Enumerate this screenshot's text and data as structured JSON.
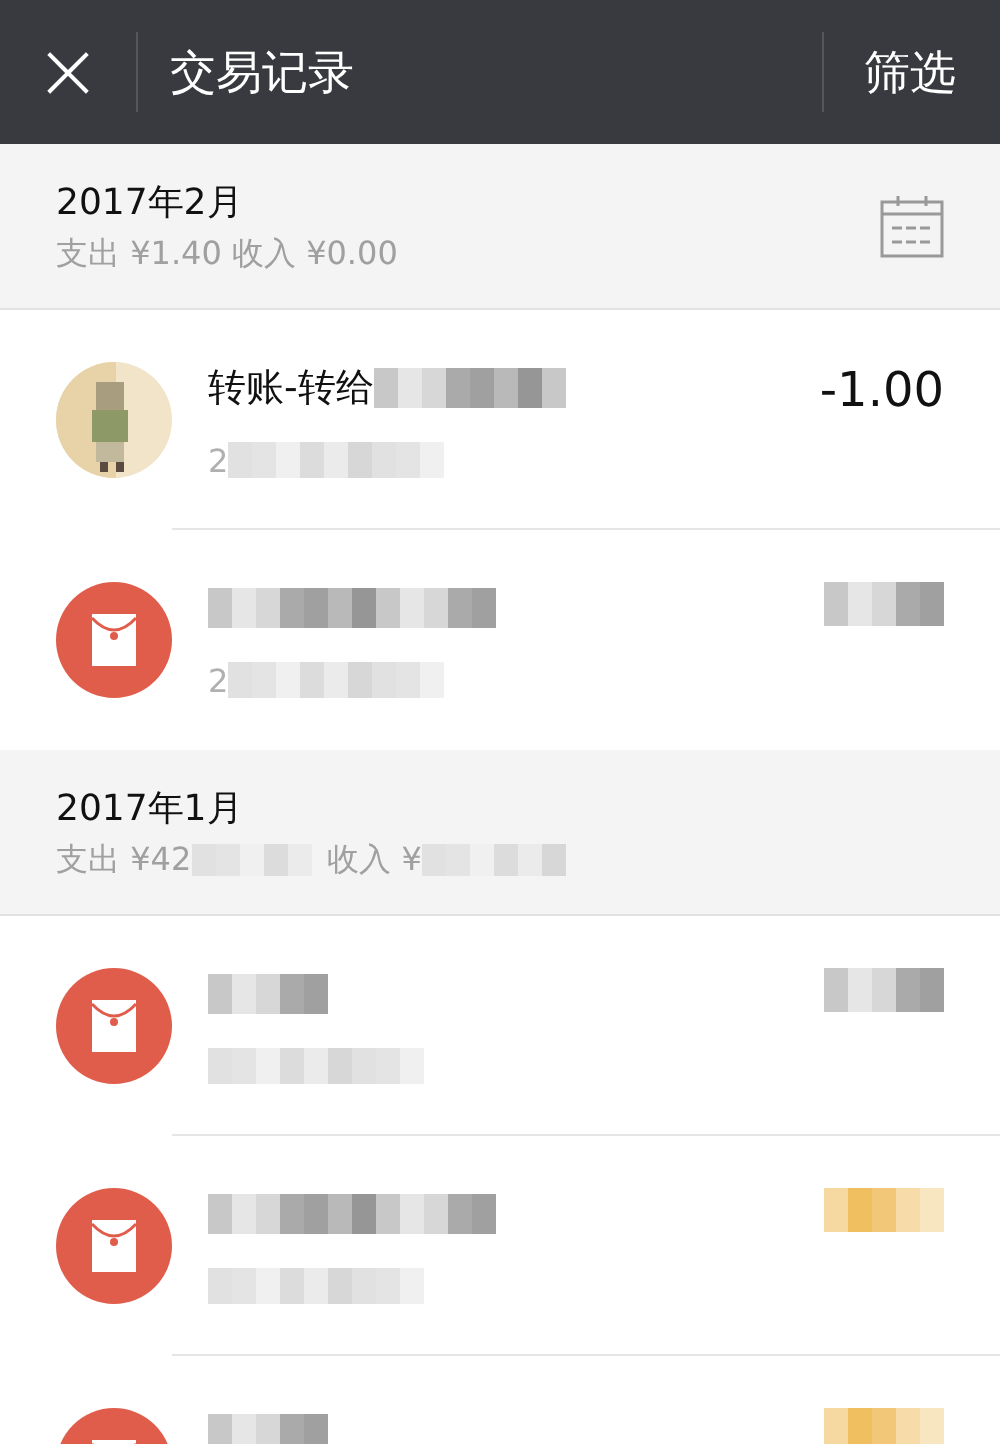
{
  "header": {
    "close": "×",
    "title": "交易记录",
    "filter": "筛选"
  },
  "months": [
    {
      "title": "2017年2月",
      "calendar": true,
      "summary": [
        {
          "text": "支出 ¥1.40 收入 ¥0.00",
          "blurred": false
        }
      ],
      "transactions": [
        {
          "title": "转账-转给",
          "title_blurred": true,
          "date": "2",
          "date_blurred": true,
          "amount": "-1.00",
          "amount_blurred": false,
          "income": false
        },
        {
          "kind": "red-packet",
          "title_blurred": true,
          "date": "2",
          "date_blurred": true,
          "amount_blurred": true,
          "income": false
        }
      ]
    },
    {
      "title": "2017年1月",
      "calendar": false,
      "summary": [
        {
          "text": "支出 ¥42",
          "blurred": true
        },
        {
          "text": "收入 ¥",
          "blurred": true
        }
      ],
      "transactions": [
        {
          "kind": "red-packet",
          "title_blurred": true,
          "date_blurred": true,
          "amount_blurred": true,
          "income": false
        },
        {
          "kind": "red-packet",
          "title_blurred": true,
          "date_blurred": true,
          "amount_blurred": true,
          "income": true
        },
        {
          "kind": "red-packet",
          "title_blurred": true,
          "date_blurred": false,
          "amount_blurred": true,
          "income": true
        }
      ]
    }
  ]
}
